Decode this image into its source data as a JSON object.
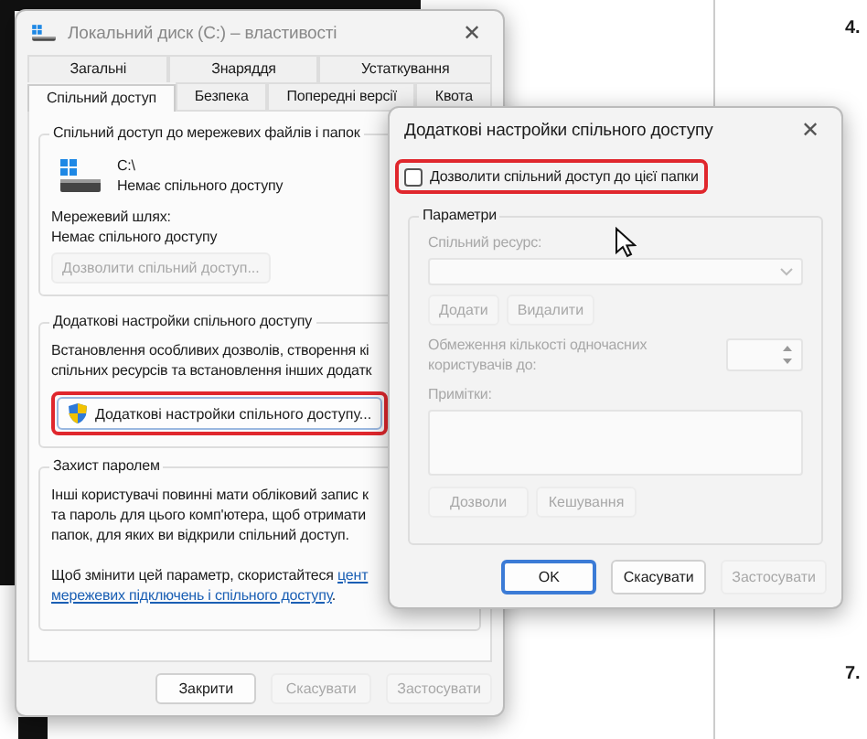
{
  "document": {
    "numbers": [
      "4.",
      "7."
    ]
  },
  "properties_window": {
    "title": "Локальний диск (C:) – властивості",
    "close_glyph": "✕",
    "tabs_row_1": [
      {
        "label": "Загальні",
        "selected": false
      },
      {
        "label": "Знаряддя",
        "selected": false
      },
      {
        "label": "Устаткування",
        "selected": false
      }
    ],
    "tabs_row_2": [
      {
        "label": "Спільний доступ",
        "selected": true
      },
      {
        "label": "Безпека",
        "selected": false
      },
      {
        "label": "Попередні версії",
        "selected": false
      },
      {
        "label": "Квота",
        "selected": false
      }
    ],
    "network_sharing": {
      "heading": "Спільний доступ до мережевих файлів і папок",
      "drive": "C:\\",
      "drive_status": "Немає спільного доступу",
      "path_label": "Мережевий шлях:",
      "path_value": "Немає спільного доступу",
      "button": {
        "label": "Дозволити спільний доступ...",
        "disabled": true
      }
    },
    "advanced_sharing": {
      "heading": "Додаткові настройки спільного доступу",
      "description_lines": [
        "Встановлення особливих дозволів, створення кі",
        "спільних ресурсів та встановлення інших додатк"
      ],
      "button": {
        "label": "Додаткові настройки спільного доступу...",
        "highlighted": true
      }
    },
    "password_protection": {
      "heading": "Захист паролем",
      "description_lines": [
        "Інші користувачі повинні мати обліковий запис к",
        "та пароль для цього комп'ютера, щоб отримати",
        "папок, для яких ви відкрили спільний доступ."
      ],
      "change_text": "Щоб змінити цей параметр, скористайтеся",
      "link_lines": [
        "цент",
        "мережевих підключень і спільного доступу"
      ],
      "change_end": "."
    },
    "buttons": [
      {
        "label": "Закрити",
        "disabled": false
      },
      {
        "label": "Скасувати",
        "disabled": true
      },
      {
        "label": "Застосувати",
        "disabled": true
      }
    ]
  },
  "advanced_dialog": {
    "title": "Додаткові настройки спільного доступу",
    "close_glyph": "✕",
    "share_checkbox": {
      "label": "Дозволити спільний доступ до цієї папки",
      "checked": false,
      "highlighted": true
    },
    "parameters": {
      "heading": "Параметри",
      "disabled": true,
      "share_name_label": "Спільний ресурс:",
      "buttons_1": [
        "Додати",
        "Видалити"
      ],
      "limit_label": "Обмеження кількості одночасних користувачів до:",
      "comments_label": "Примітки:",
      "buttons_2": [
        "Дозволи",
        "Кешування"
      ]
    },
    "buttons": [
      {
        "label": "OK",
        "default": true,
        "disabled": false
      },
      {
        "label": "Скасувати",
        "default": false,
        "disabled": false
      },
      {
        "label": "Застосувати",
        "default": false,
        "disabled": true
      }
    ]
  }
}
